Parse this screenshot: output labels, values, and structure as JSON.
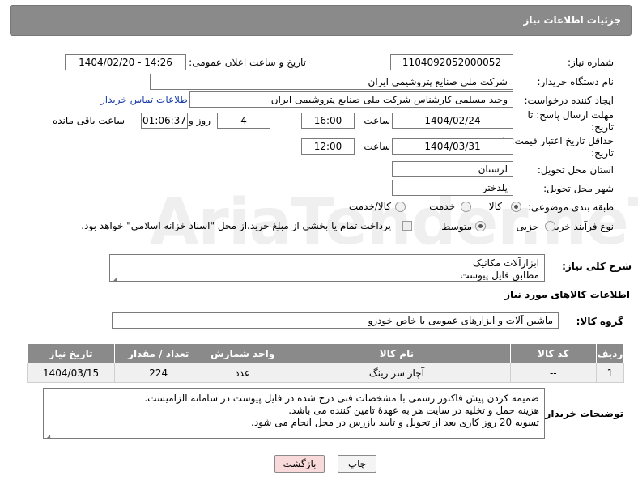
{
  "header": {
    "title": "جزئیات اطلاعات نیاز"
  },
  "watermark": {
    "text": "AriaTender.neT"
  },
  "fields": {
    "need_number_label": "شماره نیاز:",
    "need_number": "1104092052000052",
    "announce_label": "تاریخ و ساعت اعلان عمومی:",
    "announce_value": "1404/02/20 - 14:26",
    "buyer_org_label": "نام دستگاه خریدار:",
    "buyer_org": "شرکت ملی صنایع پتروشیمی ایران",
    "creator_label": "ایجاد کننده درخواست:",
    "creator": "وحید مسلمی کارشناس شرکت ملی صنایع پتروشیمی ایران",
    "contact_link": "اطلاعات تماس خریدار",
    "deadline_label": "مهلت ارسال پاسخ: تا تاریخ:",
    "deadline_date": "1404/02/24",
    "time_label": "ساعت",
    "deadline_time": "16:00",
    "days_value": "4",
    "days_label": "روز و",
    "remaining_time": "01:06:37",
    "remaining_label": "ساعت باقی مانده",
    "validity_label": "حداقل تاریخ اعتبار قیمت: تا تاریخ:",
    "validity_date": "1404/03/31",
    "validity_time": "12:00",
    "province_label": "استان محل تحویل:",
    "province": "لرستان",
    "city_label": "شهر محل تحویل:",
    "city": "پلدختر",
    "category_label": "طبقه بندی موضوعی:",
    "category_options": [
      "کالا",
      "خدمت",
      "کالا/خدمت"
    ],
    "process_label": "نوع فرآیند خرید :",
    "process_options": [
      "جزیی",
      "متوسط"
    ],
    "process_note": "پرداخت تمام یا بخشی از مبلغ خرید،از محل \"اسناد خزانه اسلامی\" خواهد بود."
  },
  "description": {
    "label": "شرح کلی نیاز:",
    "line1": "ابزارآلات مکانیک",
    "line2": "مطابق فایل پیوست"
  },
  "goods_info": {
    "section_title": "اطلاعات کالاهای مورد نیاز",
    "group_label": "گروه کالا:",
    "group_value": "ماشین آلات و ابزارهای عمومی یا خاص خودرو"
  },
  "table": {
    "headers": [
      "ردیف",
      "کد کالا",
      "نام کالا",
      "واحد شمارش",
      "تعداد / مقدار",
      "تاریخ نیاز"
    ],
    "rows": [
      [
        "1",
        "--",
        "آچار سر رینگ",
        "عدد",
        "224",
        "1404/03/15"
      ]
    ]
  },
  "buyer_notes": {
    "label": "توضیحات خریدار:",
    "line1": "ضمیمه کردن پیش فاکتور رسمی با مشخصات فنی درج شده در فایل پیوست در سامانه الزامیست.",
    "line2": "هزینه حمل و تخلیه در سایت هر به عهدهٔ تامین کننده می باشد.",
    "line3": "تسویه 20 روز کاری بعد از تحویل و تایید بازرس در محل انجام می شود."
  },
  "buttons": {
    "print": "چاپ",
    "back": "بازگشت"
  }
}
